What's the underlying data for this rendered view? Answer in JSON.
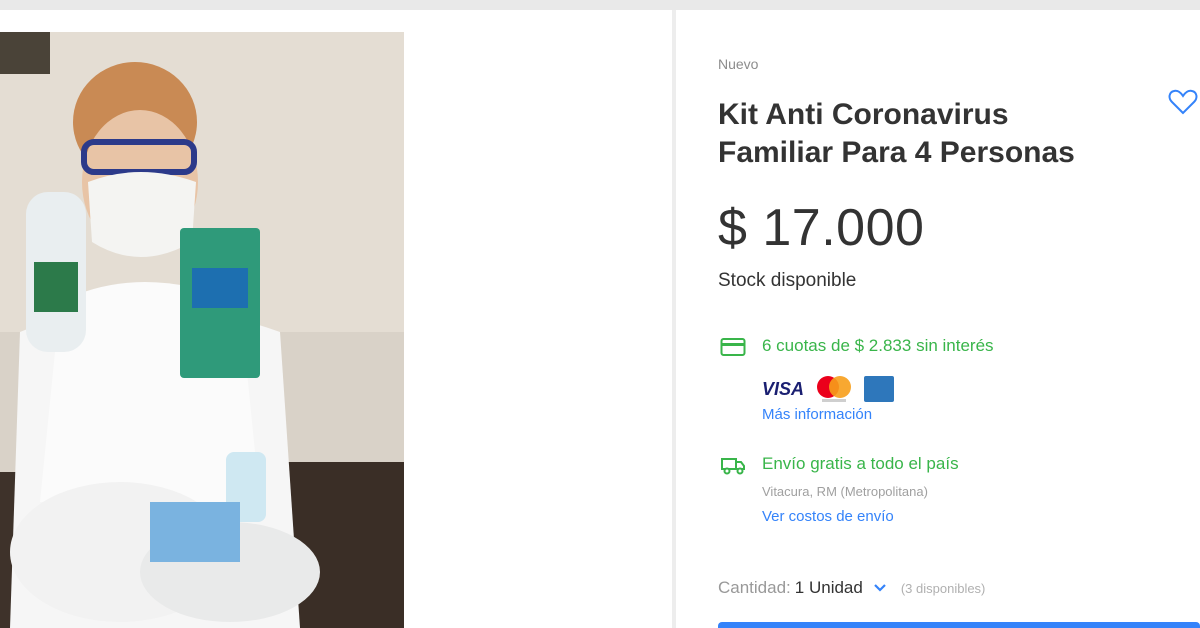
{
  "product": {
    "condition": "Nuevo",
    "title_line1": "Kit Anti Coronavirus",
    "title_line2": "Familiar Para 4 Personas",
    "price": "$ 17.000",
    "stock": "Stock disponible"
  },
  "payment": {
    "installments": "6 cuotas de $ 2.833 sin interés",
    "visa_label": "VISA",
    "more_info": "Más información"
  },
  "shipping": {
    "text": "Envío gratis a todo el país",
    "location": "Vitacura, RM (Metropolitana)",
    "costs_link": "Ver costos de envío"
  },
  "quantity": {
    "label": "Cantidad:",
    "value": "1 Unidad",
    "available": "(3 disponibles)"
  },
  "icons": {
    "favorite": "heart-icon",
    "card": "credit-card-icon",
    "truck": "truck-icon",
    "dropdown": "chevron-down-icon"
  },
  "colors": {
    "accent": "#3483fa",
    "success": "#39b54a",
    "text": "#333333",
    "muted": "#999999"
  }
}
